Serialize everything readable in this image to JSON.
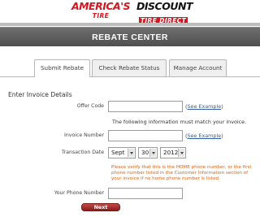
{
  "logos": {
    "americas_tire_main": "AMERICA'S",
    "americas_tire_sub": "TIRE",
    "discount_tire_main": "DISCOUNT",
    "discount_tire_sub": "TIRE DIRECT"
  },
  "banner": {
    "title": "REBATE CENTER"
  },
  "tabs": [
    {
      "label": "Submit Rebate",
      "active": true
    },
    {
      "label": "Check Rebate Status",
      "active": false
    },
    {
      "label": "Manage Account",
      "active": false
    }
  ],
  "form": {
    "section_title": "Enter Invoice Details",
    "offer_code": {
      "label": "Offer Code",
      "value": ""
    },
    "see_example_open": "(",
    "see_example_link": "See Example",
    "see_example_close": ")",
    "invoice_match_note": "The following information must match your invoice.",
    "invoice_number": {
      "label": "Invoice Number",
      "value": ""
    },
    "transaction_date": {
      "label": "Transaction Date",
      "month": "Sept",
      "day": "30",
      "year": "2012"
    },
    "phone_warning": "Please verify that this is the HOME phone number, or the first phone number listed in the Customer Information section of your invoice if no home phone number is listed.",
    "phone_number": {
      "label": "Your Phone Number",
      "value": ""
    },
    "next_label": "Next"
  },
  "colors": {
    "accent_red": "#d3161f",
    "banner_gray": "#5f5f5f",
    "warning_orange": "#d9651b",
    "link_blue": "#2f5fa8"
  }
}
